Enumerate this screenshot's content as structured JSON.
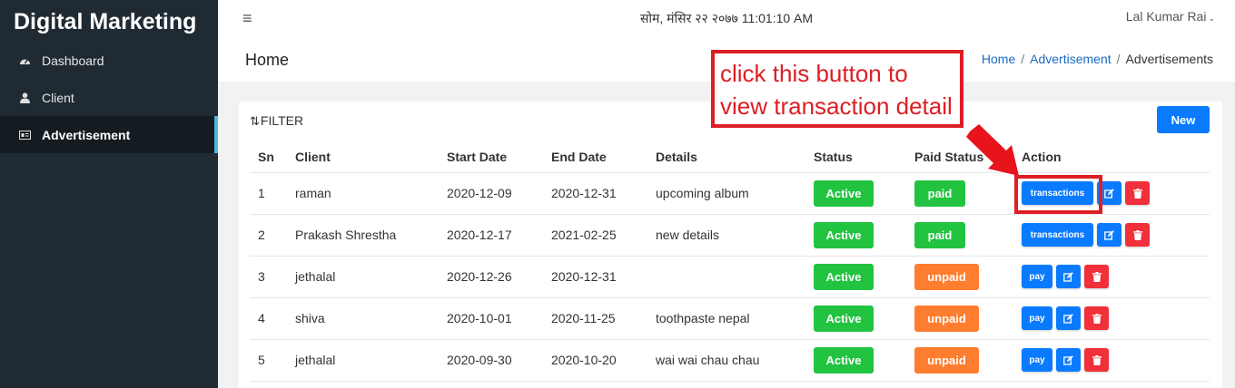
{
  "sidebar": {
    "brand": "Digital Marketing",
    "items": [
      {
        "label": "Dashboard",
        "icon": "dashboard-icon"
      },
      {
        "label": "Client",
        "icon": "user-icon"
      },
      {
        "label": "Advertisement",
        "icon": "ad-icon"
      }
    ],
    "active_item": "Advertisement"
  },
  "topbar": {
    "datetime": "सोम, मंसिर २२ २०७७ 11:01:10 AM",
    "user": "Lal Kumar Rai"
  },
  "header": {
    "title": "Home",
    "breadcrumb": [
      "Home",
      "Advertisement",
      "Advertisements"
    ]
  },
  "card": {
    "filter_label": "FILTER",
    "new_label": "New"
  },
  "table": {
    "columns": [
      "Sn",
      "Client",
      "Start Date",
      "End Date",
      "Details",
      "Status",
      "Paid Status",
      "Action"
    ],
    "rows": [
      {
        "sn": "1",
        "client": "raman",
        "start": "2020-12-09",
        "end": "2020-12-31",
        "details": "upcoming album",
        "status": "Active",
        "paid": "paid",
        "action": "transactions"
      },
      {
        "sn": "2",
        "client": "Prakash Shrestha",
        "start": "2020-12-17",
        "end": "2021-02-25",
        "details": "new details",
        "status": "Active",
        "paid": "paid",
        "action": "transactions"
      },
      {
        "sn": "3",
        "client": "jethalal",
        "start": "2020-12-26",
        "end": "2020-12-31",
        "details": "",
        "status": "Active",
        "paid": "unpaid",
        "action": "pay"
      },
      {
        "sn": "4",
        "client": "shiva",
        "start": "2020-10-01",
        "end": "2020-11-25",
        "details": "toothpaste nepal",
        "status": "Active",
        "paid": "unpaid",
        "action": "pay"
      },
      {
        "sn": "5",
        "client": "jethalal",
        "start": "2020-09-30",
        "end": "2020-10-20",
        "details": "wai wai chau chau",
        "status": "Active",
        "paid": "unpaid",
        "action": "pay"
      }
    ]
  },
  "annotation": {
    "line1": "click this button to",
    "line2": "view transaction detail"
  },
  "colors": {
    "sidebar_bg": "#1f2a32",
    "primary": "#0a7bff",
    "success": "#22c341",
    "warning": "#ff7d2e",
    "danger": "#f0303a",
    "annotation": "#dd1e24"
  }
}
